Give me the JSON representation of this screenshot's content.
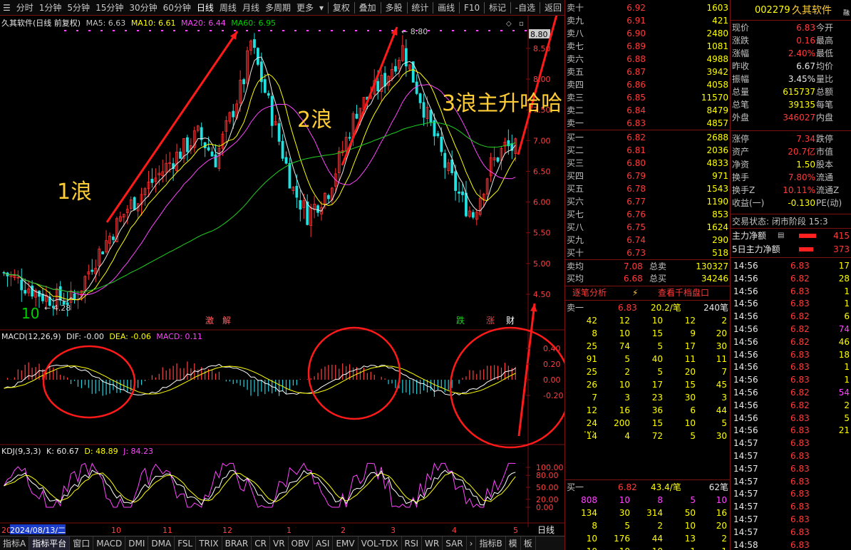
{
  "toolbar": {
    "items": [
      "分时",
      "1分钟",
      "5分钟",
      "15分钟",
      "30分钟",
      "60分钟",
      "日线",
      "周线",
      "月线",
      "多周期",
      "更多"
    ],
    "right_items": [
      "复权",
      "叠加",
      "多股",
      "统计",
      "画线",
      "F10",
      "标记",
      "-自选",
      "返回"
    ]
  },
  "chart": {
    "title": "久其软件(日线 前复权)",
    "ma5": "MA5: 6.63",
    "ma10": "MA10: 6.61",
    "ma20": "MA20: 6.44",
    "ma60": "MA60: 6.95",
    "price_axis": [
      "8.50",
      "8.00",
      "7.50",
      "7.00",
      "6.50",
      "6.00",
      "5.50",
      "5.00",
      "4.50"
    ],
    "price_tag": "8.80",
    "high_label": "8.80",
    "low_label": "4.28",
    "annotations": {
      "wave1": "1浪",
      "wave2": "2浪",
      "wave3": "3浪主升哈哈",
      "ten": "10"
    },
    "signals": [
      "激",
      "解",
      "跌",
      "涨",
      "财"
    ],
    "macd_title": "MACD(12,26,9)",
    "dif": "DIF: -0.00",
    "dea": "DEA: -0.06",
    "macd": "MACD: 0.11",
    "macd_axis": [
      "0.40",
      "0.20",
      "0.00",
      "-0.20"
    ],
    "kdj_title": "KDJ(9,3,3)",
    "k": "K: 60.67",
    "d": "D: 48.89",
    "j": "J: 84.23",
    "kdj_axis": [
      "100.00",
      "80.00",
      "50.00",
      "20.00",
      "0.00"
    ],
    "date_axis": [
      "20",
      "2024/08/13/二",
      "10",
      "11",
      "12",
      "1",
      "2",
      "3",
      "4",
      "5"
    ],
    "period_label": "日线"
  },
  "order_book": {
    "asks": [
      {
        "label": "卖十",
        "price": "6.92",
        "vol": "1603"
      },
      {
        "label": "卖九",
        "price": "6.91",
        "vol": "421"
      },
      {
        "label": "卖八",
        "price": "6.90",
        "vol": "2480"
      },
      {
        "label": "卖七",
        "price": "6.89",
        "vol": "1081"
      },
      {
        "label": "卖六",
        "price": "6.88",
        "vol": "4988"
      },
      {
        "label": "卖五",
        "price": "6.87",
        "vol": "3942"
      },
      {
        "label": "卖四",
        "price": "6.86",
        "vol": "4058"
      },
      {
        "label": "卖三",
        "price": "6.85",
        "vol": "11570"
      },
      {
        "label": "卖二",
        "price": "6.84",
        "vol": "8479"
      },
      {
        "label": "卖一",
        "price": "6.83",
        "vol": "4857"
      }
    ],
    "bids": [
      {
        "label": "买一",
        "price": "6.82",
        "vol": "2688"
      },
      {
        "label": "买二",
        "price": "6.81",
        "vol": "2036"
      },
      {
        "label": "买三",
        "price": "6.80",
        "vol": "4833"
      },
      {
        "label": "买四",
        "price": "6.79",
        "vol": "971"
      },
      {
        "label": "买五",
        "price": "6.78",
        "vol": "1543"
      },
      {
        "label": "买六",
        "price": "6.77",
        "vol": "1190"
      },
      {
        "label": "买七",
        "price": "6.76",
        "vol": "853"
      },
      {
        "label": "买八",
        "price": "6.75",
        "vol": "1624"
      },
      {
        "label": "买九",
        "price": "6.74",
        "vol": "290"
      },
      {
        "label": "买十",
        "price": "6.73",
        "vol": "518"
      }
    ],
    "avg_ask_label": "卖均",
    "avg_ask": "7.08",
    "total_ask_label": "总卖",
    "total_ask": "130327",
    "avg_bid_label": "买均",
    "avg_bid": "6.68",
    "total_bid_label": "总买",
    "total_bid": "34246",
    "tick_tab": "逐笔分析",
    "thousand_tab": "查看千档盘口",
    "ask1_label": "卖一",
    "ask1_price": "6.83",
    "ask1_lots": "20.2/笔",
    "ask1_count": "240笔",
    "ask_queue": [
      [
        "42",
        "12",
        "10",
        "12",
        "2"
      ],
      [
        "8",
        "10",
        "15",
        "9",
        "20"
      ],
      [
        "25",
        "74",
        "5",
        "17",
        "30"
      ],
      [
        "91",
        "5",
        "40",
        "11",
        "11"
      ],
      [
        "25",
        "2",
        "5",
        "20",
        "7"
      ],
      [
        "26",
        "10",
        "17",
        "15",
        "45"
      ],
      [
        "7",
        "3",
        "23",
        "30",
        "3"
      ],
      [
        "12",
        "16",
        "36",
        "6",
        "44"
      ],
      [
        "24",
        "200",
        "15",
        "10",
        "5"
      ],
      [
        "14",
        "4",
        "72",
        "5",
        "30"
      ]
    ],
    "ellipsis": "....",
    "bid1_label": "买一",
    "bid1_price": "6.82",
    "bid1_lots": "43.4/笔",
    "bid1_count": "62笔",
    "bid_queue": [
      [
        "808",
        "10",
        "8",
        "5",
        "10"
      ],
      [
        "134",
        "30",
        "314",
        "50",
        "16"
      ],
      [
        "8",
        "5",
        "2",
        "10",
        "20"
      ],
      [
        "10",
        "176",
        "44",
        "13",
        "2"
      ],
      [
        "10",
        "10",
        "10",
        "1",
        "1"
      ]
    ]
  },
  "quote": {
    "code": "002279",
    "name": "久其软件",
    "tag": "融",
    "rows": [
      {
        "l": "现价",
        "v": "6.83",
        "r": "今开"
      },
      {
        "l": "涨跌",
        "v": "0.16",
        "r": "最高"
      },
      {
        "l": "涨幅",
        "v": "2.40%",
        "r": "最低"
      },
      {
        "l": "昨收",
        "v": "6.67",
        "r": "均价"
      },
      {
        "l": "振幅",
        "v": "3.45%",
        "r": "量比"
      },
      {
        "l": "总量",
        "v": "615737",
        "r": "总额"
      },
      {
        "l": "总笔",
        "v": "39135",
        "r": "每笔"
      },
      {
        "l": "外盘",
        "v": "346027",
        "r": "内盘"
      },
      {
        "l": "涨停",
        "v": "7.34",
        "r": "跌停"
      },
      {
        "l": "资产",
        "v": "20.7亿",
        "r": "市值"
      },
      {
        "l": "净资",
        "v": "1.50",
        "r": "股本"
      },
      {
        "l": "换手",
        "v": "7.80%",
        "r": "流通"
      },
      {
        "l": "换手Z",
        "v": "10.11%",
        "r": "流通Z"
      },
      {
        "l": "收益(一)",
        "v": "-0.130",
        "r": "PE(动)"
      }
    ],
    "status": "交易状态: 闭市阶段 15:3",
    "main_flow_label": "主力净额",
    "main_flow": "415",
    "main5_label": "5日主力净额",
    "main5": "373",
    "ticks": [
      {
        "t": "14:56",
        "p": "6.83",
        "v": "17"
      },
      {
        "t": "14:56",
        "p": "6.82",
        "v": "28"
      },
      {
        "t": "14:56",
        "p": "6.83",
        "v": "1"
      },
      {
        "t": "14:56",
        "p": "6.83",
        "v": "1"
      },
      {
        "t": "14:56",
        "p": "6.82",
        "v": "6"
      },
      {
        "t": "14:56",
        "p": "6.82",
        "v": "74"
      },
      {
        "t": "14:56",
        "p": "6.82",
        "v": "46"
      },
      {
        "t": "14:56",
        "p": "6.83",
        "v": "18"
      },
      {
        "t": "14:56",
        "p": "6.83",
        "v": "1"
      },
      {
        "t": "14:56",
        "p": "6.83",
        "v": "1"
      },
      {
        "t": "14:56",
        "p": "6.82",
        "v": "54"
      },
      {
        "t": "14:56",
        "p": "6.82",
        "v": "2"
      },
      {
        "t": "14:56",
        "p": "6.83",
        "v": "5"
      },
      {
        "t": "14:56",
        "p": "6.83",
        "v": "21"
      },
      {
        "t": "14:57",
        "p": "6.83",
        "v": ""
      },
      {
        "t": "14:57",
        "p": "6.83",
        "v": ""
      },
      {
        "t": "14:57",
        "p": "6.83",
        "v": ""
      },
      {
        "t": "14:57",
        "p": "6.83",
        "v": ""
      },
      {
        "t": "14:57",
        "p": "6.83",
        "v": ""
      },
      {
        "t": "14:57",
        "p": "6.83",
        "v": ""
      },
      {
        "t": "14:57",
        "p": "6.83",
        "v": ""
      },
      {
        "t": "14:57",
        "p": "6.83",
        "v": ""
      },
      {
        "t": "14:58",
        "p": "6.83",
        "v": ""
      },
      {
        "t": "14:58",
        "p": "6.83",
        "v": ""
      }
    ]
  },
  "bottom_tabs": [
    "指标A",
    "指标平台",
    "窗口",
    "MACD",
    "DMI",
    "DMA",
    "FSL",
    "TRIX",
    "BRAR",
    "CR",
    "VR",
    "OBV",
    "ASI",
    "EMV",
    "VOL-TDX",
    "RSI",
    "WR",
    "SAR",
    "›",
    "指标B",
    "模",
    "板"
  ]
}
